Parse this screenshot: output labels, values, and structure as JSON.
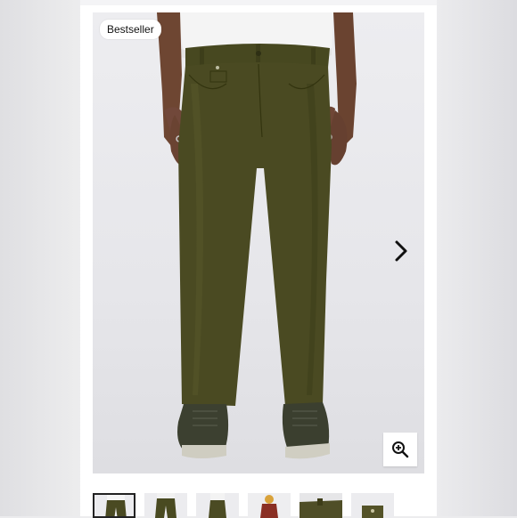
{
  "badge": {
    "label": "Bestseller"
  },
  "product_image": {
    "description_icon": "olive-pants-photo",
    "pants_color": "#4a4a22",
    "shirt_color": "#f3f3f3",
    "skin_color": "#6b4430",
    "shoe_color": "#3c4030"
  },
  "controls": {
    "next_icon": "chevron-right-icon",
    "zoom_icon": "zoom-in-icon"
  },
  "thumbnails": [
    {
      "view": "front",
      "active": true
    },
    {
      "view": "back",
      "active": false
    },
    {
      "view": "side",
      "active": false
    },
    {
      "view": "model-lifestyle",
      "active": false
    },
    {
      "view": "waistband-detail",
      "active": false
    },
    {
      "view": "pocket-detail",
      "active": false
    }
  ]
}
